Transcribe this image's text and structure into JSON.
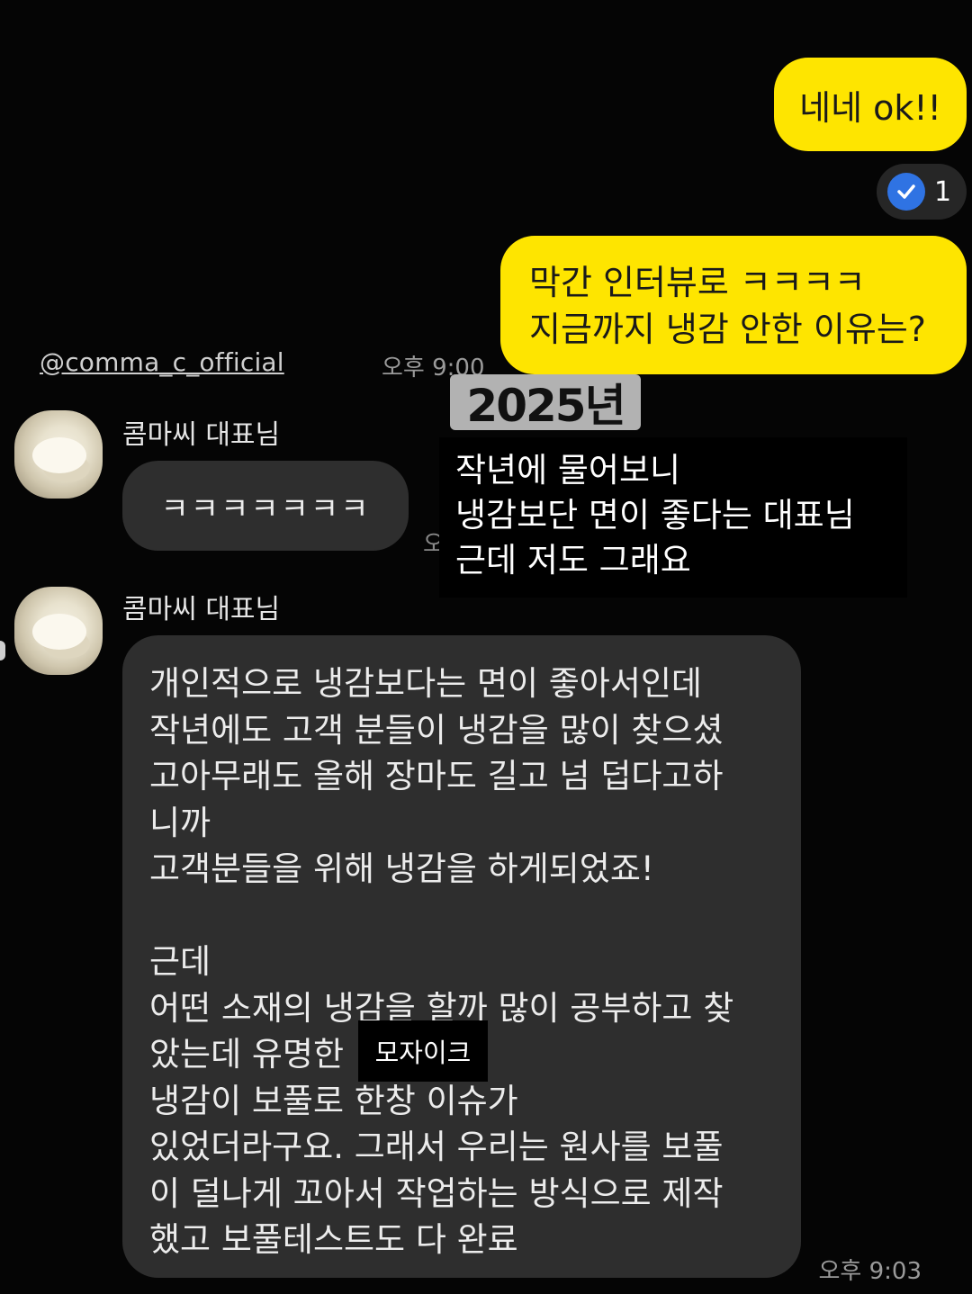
{
  "outgoing": {
    "msg1": "네네 ok!!",
    "read_count": "1",
    "msg2_lines": [
      "막간 인터뷰로 ㅋㅋㅋㅋ",
      "지금까지 냉감 안한 이유는?"
    ]
  },
  "watermark_handle": "@comma_c_official",
  "times": {
    "t1": "오후 9:00",
    "t2_partial": "오",
    "t3": "오후 9:03"
  },
  "incoming": {
    "sender_name": "콤마씨 대표님",
    "msg1": "ㅋㅋㅋㅋㅋㅋㅋ",
    "msg2_lines": [
      "개인적으로 냉감보다는 면이 좋아서인데",
      "작년에도 고객 분들이 냉감을 많이 찾으셨",
      "고아무래도 올해 장마도 길고 넘 덥다고하",
      "니까",
      "고객분들을 위해 냉감을 하게되었죠!",
      "",
      "근데",
      "어떤 소재의 냉감을 할까 많이 공부하고 찾",
      "았는데 유명한",
      "냉감이 보풀로 한창 이슈가",
      "있었더라구요. 그래서 우리는 원사를 보풀",
      "이 덜나게 꼬아서 작업하는 방식으로 제작",
      "했고 보풀테스트도 다 완료"
    ]
  },
  "overlay": {
    "year": "2025년",
    "caption_lines": [
      "작년에 물어보니",
      "냉감보단 면이 좋다는 대표님",
      "근데 저도 그래요"
    ],
    "mosaic": "모자이크"
  },
  "colors": {
    "outgoing_bubble": "#fee500",
    "incoming_bubble": "#2e2e2e",
    "background": "#050505",
    "read_check": "#2f73e3"
  }
}
